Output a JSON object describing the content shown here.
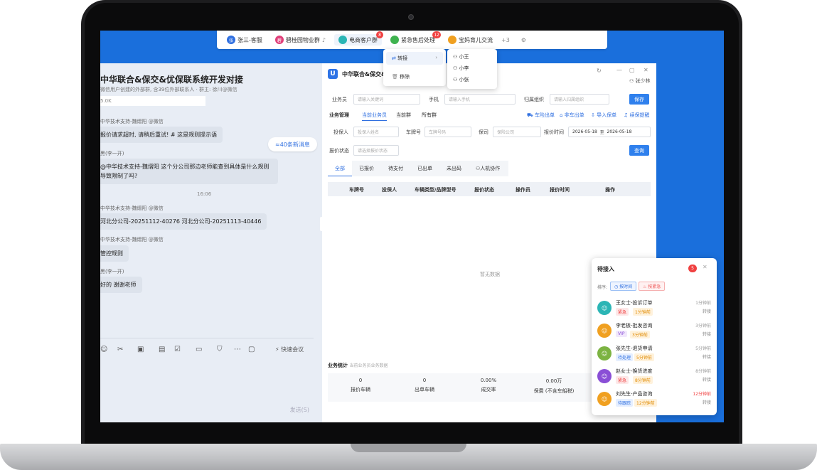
{
  "taskbar": {
    "tabs": [
      {
        "label": "张三-客服",
        "color": "#2f6fe0",
        "icon": "张"
      },
      {
        "label": "碧桂园物业群",
        "color": "#e0407a",
        "icon": "碧",
        "extra": "♪"
      },
      {
        "label": "电商客户群",
        "color": "#2bb5b5",
        "icon": "",
        "badge": "8"
      },
      {
        "label": "紧急售后处理",
        "color": "#3fb34f",
        "icon": "",
        "badge": "12"
      },
      {
        "label": "宝妈育儿交流",
        "color": "#f0a020",
        "icon": ""
      }
    ],
    "more": "+3",
    "settings_icon": "gear-icon"
  },
  "chat": {
    "title": "中华联合&保交&优保联系统开发对接",
    "subtitle": "微信用户创建的外部群, 含39位外部联系人 · 群主: 徐川@微信",
    "file_size": "5.0K",
    "new_msg": "40条新消息",
    "messages": [
      {
        "name": "中华技术支持-魏熠阳 @微信",
        "text": "报价请求超时, 请稍后重试! #  这是规则提示语"
      },
      {
        "name": "黑(李一开)",
        "text": "@中华技术支持-魏熠阳 这个分公司那边老师能查到具体是什么规则\n导致限制了吗?"
      },
      {
        "name": "中华技术支持-魏熠阳 @微信",
        "text": "河北分公司-20251112-40276  河北分公司-20251113-40446"
      },
      {
        "name": "中华技术支持-魏熠阳 @微信",
        "text": "管控规则"
      },
      {
        "name": "黑(李一开)",
        "text": "好的 谢谢老师"
      }
    ],
    "time_divider": "16:06",
    "quick_meeting": "快速会议",
    "send": "发送(S)"
  },
  "dropdown_transfer": {
    "items": [
      "转接",
      "移除"
    ]
  },
  "dropdown_agents": {
    "items": [
      "小王",
      "小李",
      "小张"
    ]
  },
  "crm": {
    "title": "中华联合&保交&",
    "user": "张少林",
    "form": {
      "salesman_label": "业务员",
      "salesman_ph": "请输入关键词",
      "phone_label": "手机",
      "phone_ph": "请输入手机",
      "org_label": "归属组织",
      "org_ph": "请输入归属组织",
      "save": "保存"
    },
    "subtabs": [
      "业务管理",
      "当前业务员",
      "当前群",
      "所有群"
    ],
    "links": [
      "车险出单",
      "非车出单",
      "导入保单",
      "续保提醒"
    ],
    "filter": {
      "insured_label": "投保人",
      "insured_ph": "投保人姓名",
      "plate_label": "车牌号",
      "plate_ph": "车牌号码",
      "company_label": "保司",
      "company_ph": "保险公司",
      "quote_time_label": "报价时间",
      "date_from": "2026-05-18",
      "date_sep": "至",
      "date_to": "2026-05-18",
      "status_label": "报价状态",
      "status_ph": "请选择报价状态",
      "query": "查询"
    },
    "status_tabs": [
      "全部",
      "已报价",
      "待支付",
      "已出单",
      "未出码",
      "人机协作"
    ],
    "columns": [
      "车牌号",
      "投保人",
      "车辆类型/品牌型号",
      "报价状态",
      "操作员",
      "报价时间",
      "操作"
    ],
    "empty": "暂无数据",
    "stats_title": "业务统计",
    "stats_hint": "当前业务员业务数据",
    "stats": [
      {
        "value": "0",
        "label": "报价车辆"
      },
      {
        "value": "0",
        "label": "出单车辆"
      },
      {
        "value": "0.00%",
        "label": "成交率"
      },
      {
        "value": "0.00万",
        "label": "保费 (不含车船税)"
      }
    ]
  },
  "queue": {
    "title": "待接入",
    "count": "5",
    "sort_label": "排序:",
    "sort_time": "按时间",
    "sort_urgent": "按紧急",
    "items": [
      {
        "name": "王女士-投诉订单",
        "tag1": "紧急",
        "tag2": "1分钟前",
        "time": "1分钟前",
        "action": "转接",
        "color": "#2bb5b5",
        "tag1_color": "#f04141"
      },
      {
        "name": "李老板-批发咨询",
        "tag1": "VIP",
        "tag2": "3分钟前",
        "time": "3分钟前",
        "action": "转接",
        "color": "#f0a020",
        "tag1_color": "#8a4fd6"
      },
      {
        "name": "张先生-退货申请",
        "tag1": "待处理",
        "tag2": "5分钟前",
        "time": "5分钟前",
        "action": "转接",
        "color": "#7cb342",
        "tag1_color": "#2f6fe0"
      },
      {
        "name": "赵女士-换货进度",
        "tag1": "紧急",
        "tag2": "8分钟前",
        "time": "8分钟前",
        "action": "转接",
        "color": "#8a4fd6",
        "tag1_color": "#f04141"
      },
      {
        "name": "刘先生-产品咨询",
        "tag1": "待跟踪",
        "tag2": "12分钟前",
        "time": "12分钟前",
        "action": "转接",
        "color": "#f0a020",
        "tag1_color": "#2f6fe0"
      }
    ]
  }
}
